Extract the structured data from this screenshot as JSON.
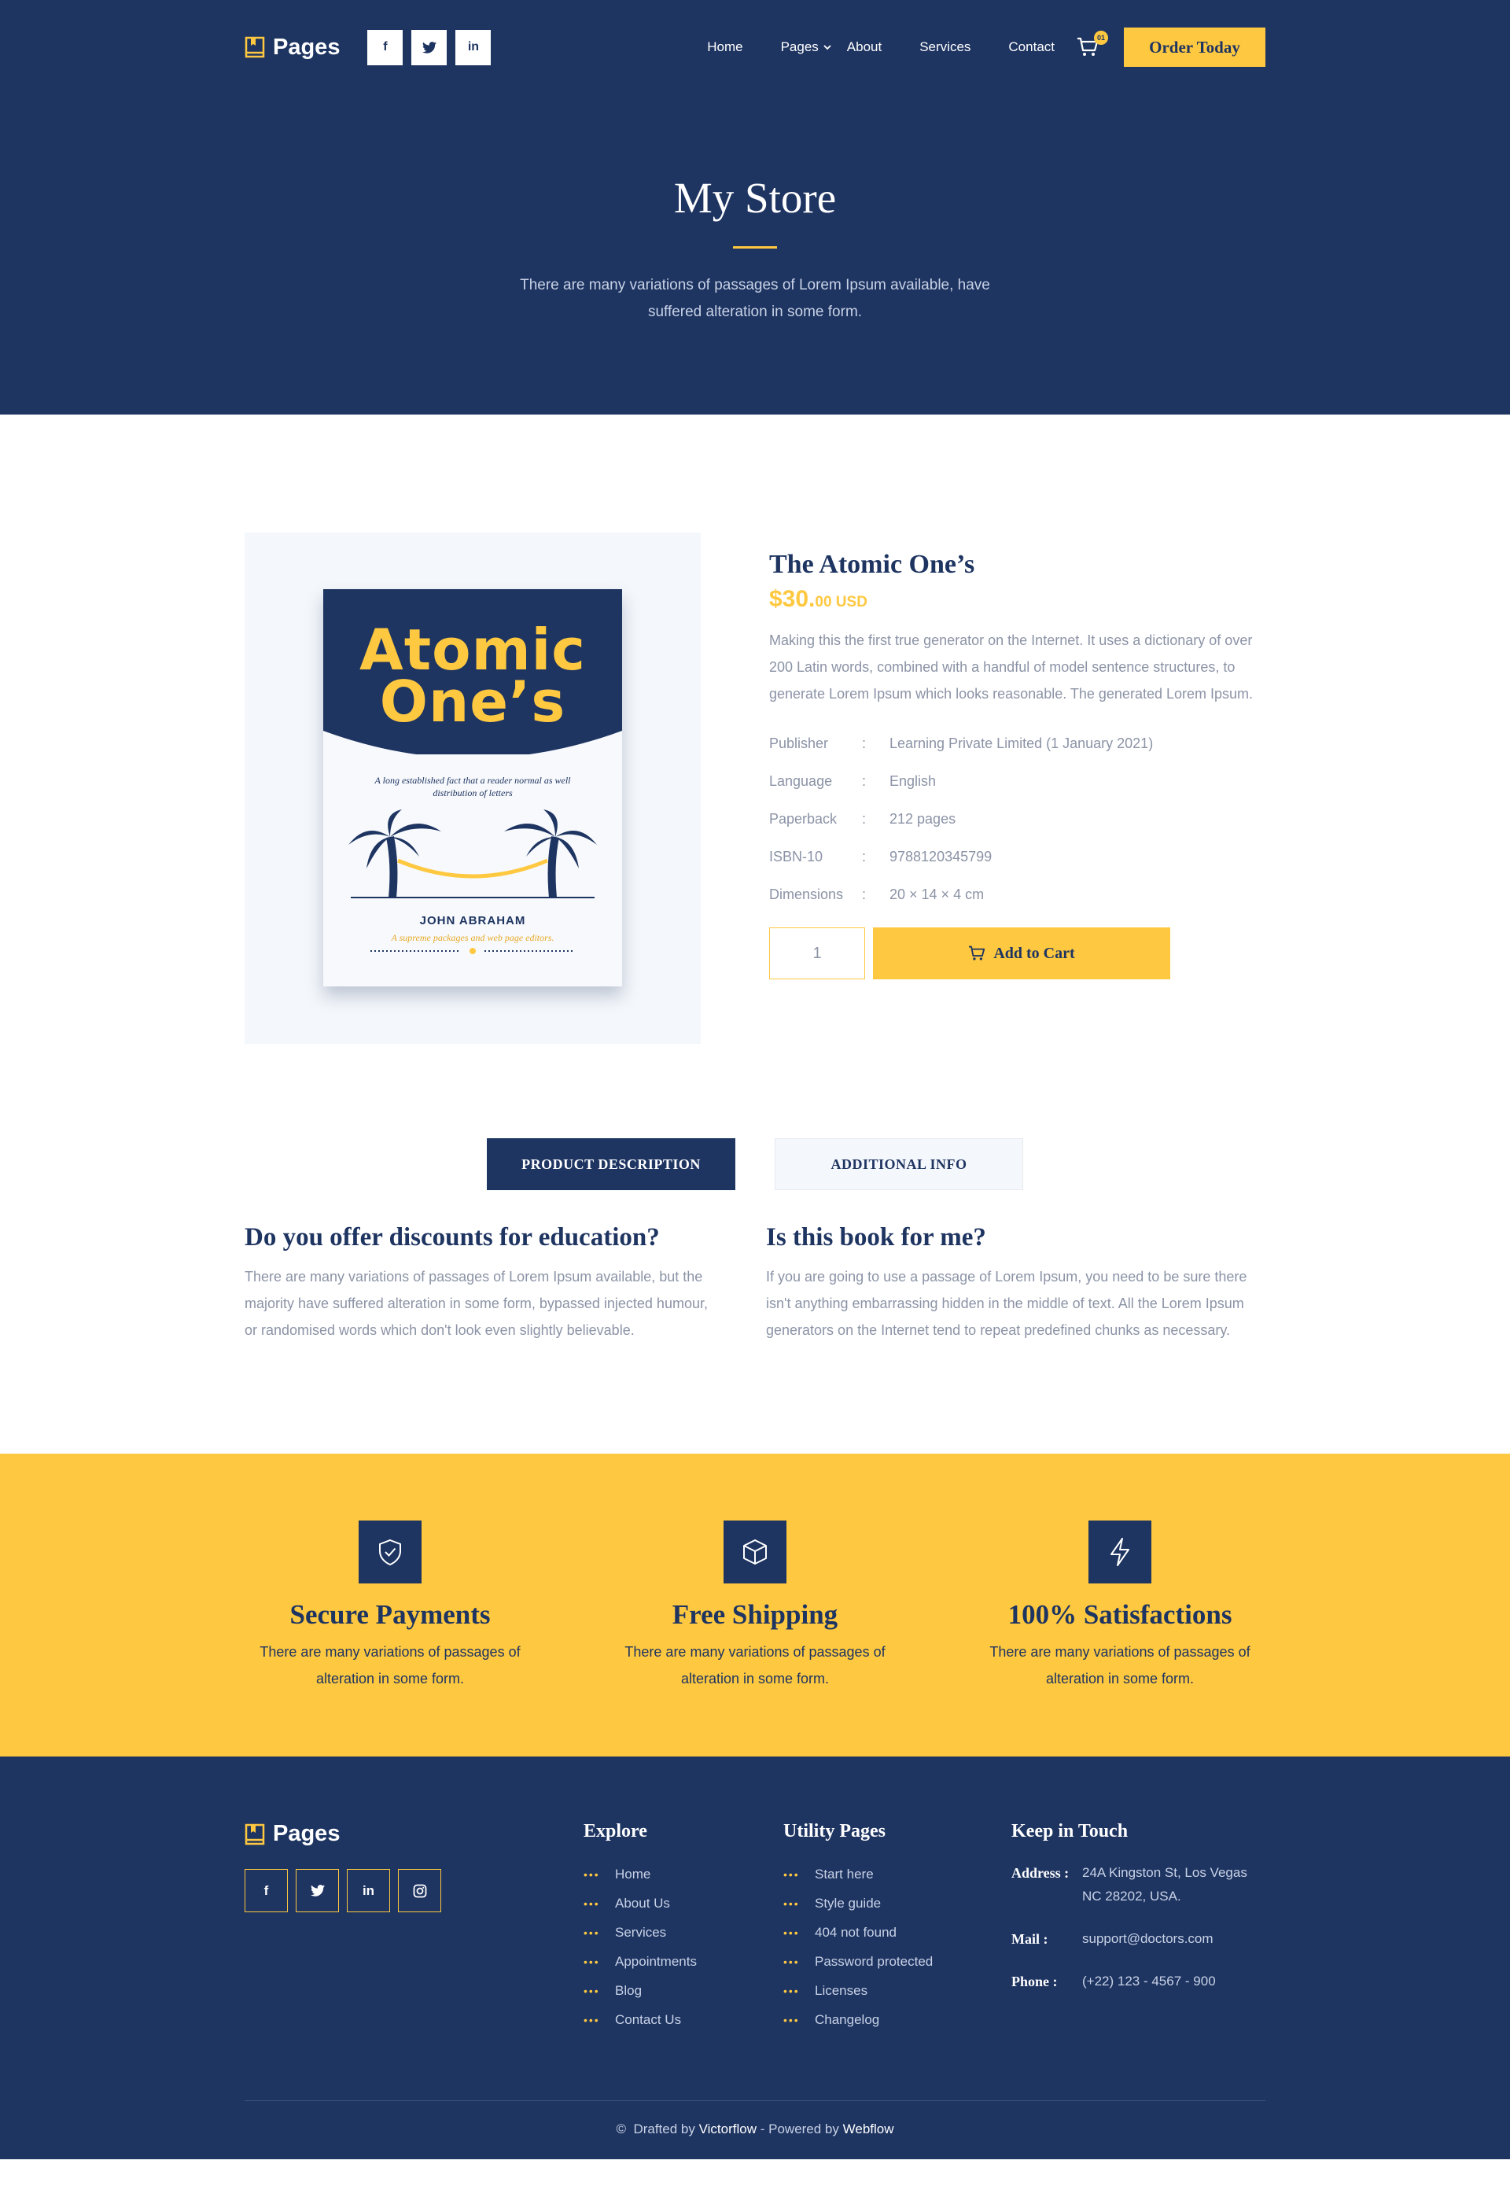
{
  "header": {
    "logo_text": "Pages",
    "socials": [
      "f",
      "t",
      "in"
    ],
    "nav": [
      "Home",
      "Pages",
      "About",
      "Services",
      "Contact"
    ],
    "cart_count": "01",
    "order_button": "Order Today"
  },
  "hero": {
    "title": "My Store",
    "text": "There are many variations of passages of Lorem Ipsum available,  have suffered alteration in some form."
  },
  "product": {
    "cover": {
      "title_line1": "Atomic",
      "title_line2": "One’s",
      "tagline": "A long established fact that a reader normal as well distribution of letters",
      "author": "JOHN ABRAHAM",
      "subtitle": "A supreme packages and web page editors."
    },
    "title": "The Atomic One’s",
    "price_main": "$30.",
    "price_cents": "00 USD",
    "description": "Making this the first true generator on the Internet. It uses a dictionary of over 200 Latin words, combined with a handful of model sentence structures, to generate Lorem Ipsum which looks reasonable. The generated Lorem Ipsum.",
    "specs": [
      {
        "key": "Publisher",
        "value": "Learning Private Limited (1 January 2021)"
      },
      {
        "key": "Language",
        "value": "English"
      },
      {
        "key": "Paperback",
        "value": "212 pages"
      },
      {
        "key": "ISBN-10",
        "value": "9788120345799"
      },
      {
        "key": "Dimensions",
        "value": "20 × 14 × 4 cm"
      }
    ],
    "quantity": "1",
    "add_to_cart": "Add to Cart"
  },
  "tabs": {
    "active": "PRODUCT DESCRIPTION",
    "inactive": "ADDITIONAL INFO"
  },
  "faqs": [
    {
      "title": "Do you offer discounts for education?",
      "text": "There are many variations of passages of Lorem Ipsum available, but the majority have suffered alteration in some form, bypassed injected humour, or randomised words which don't look even slightly believable."
    },
    {
      "title": "Is this book for me?",
      "text": "If you are going to use a passage of Lorem Ipsum, you need to be sure there isn't anything embarrassing hidden in the middle of text. All the Lorem Ipsum generators on the Internet tend to repeat predefined chunks as necessary."
    }
  ],
  "features": [
    {
      "icon": "shield-check-icon",
      "title": "Secure Payments",
      "text": "There are many variations of passages of alteration in some form."
    },
    {
      "icon": "box-icon",
      "title": "Free Shipping",
      "text": "There are many variations of passages of alteration in some form."
    },
    {
      "icon": "lightning-icon",
      "title": "100% Satisfactions",
      "text": "There are many variations of passages of alteration in some form."
    }
  ],
  "footer": {
    "logo_text": "Pages",
    "socials": [
      "f",
      "t",
      "in",
      "ig"
    ],
    "explore": {
      "heading": "Explore",
      "items": [
        "Home",
        "About Us",
        "Services",
        "Appointments",
        "Blog",
        "Contact Us"
      ]
    },
    "utility": {
      "heading": "Utility Pages",
      "items": [
        "Start here",
        "Style guide",
        "404 not found",
        "Password protected",
        "Licenses",
        "Changelog"
      ]
    },
    "contact": {
      "heading": "Keep in Touch",
      "address_label": "Address :",
      "address_line1": "24A Kingston St, Los Vegas",
      "address_line2": "NC 28202, USA.",
      "mail_label": "Mail :",
      "mail": "support@doctors.com",
      "phone_label": "Phone :",
      "phone": "(+22) 123 - 4567 - 900"
    },
    "copyright_prefix": "Drafted by",
    "drafted_by": "Victorflow",
    "powered_prefix": "- Powered by",
    "powered_by": "Webflow"
  },
  "colors": {
    "navy": "#1e3461",
    "yellow": "#fec840",
    "muted": "#8b93a6",
    "light_bg": "#f4f7fb"
  }
}
